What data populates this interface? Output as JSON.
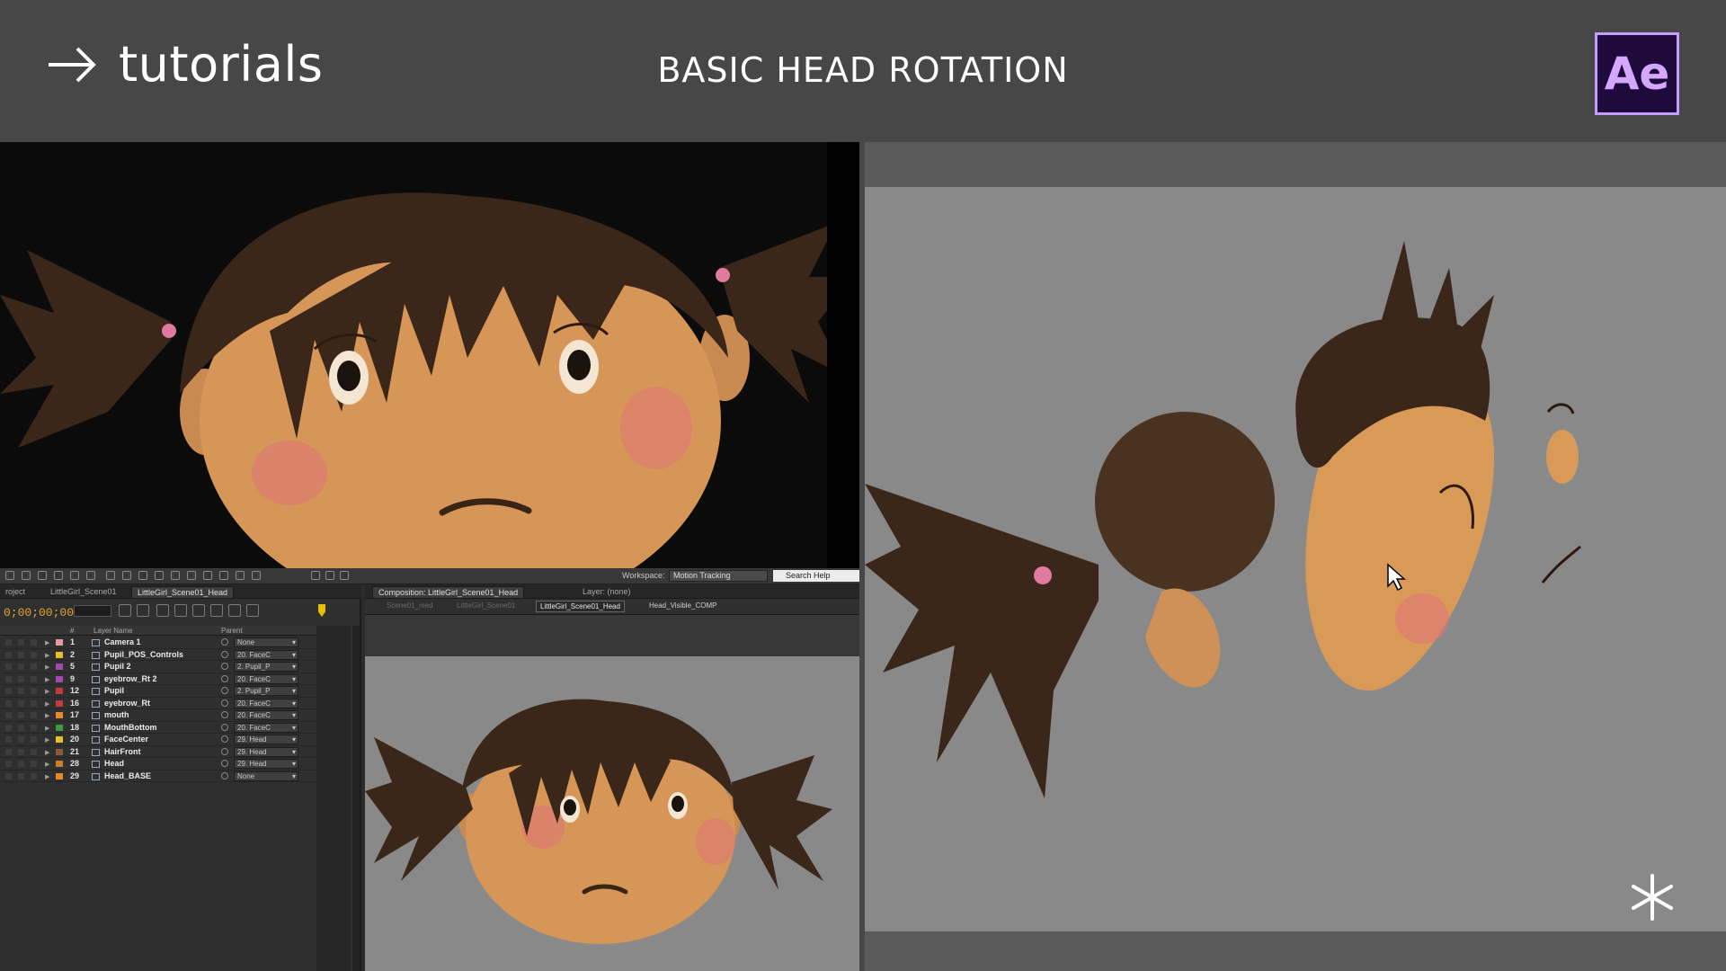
{
  "header": {
    "brand": "tutorials",
    "title": "BASIC HEAD ROTATION",
    "app_logo": "Ae"
  },
  "colors": {
    "header_bg": "#474747",
    "ae_logo_bg": "#1f0a3c",
    "ae_logo_border": "#c69cff",
    "timecode": "#e8a13a",
    "skin": "#d9955a",
    "hair": "#3d2a1c"
  },
  "icons": {
    "brand": "arrow-right-icon",
    "corner": "asterisk-icon",
    "cursor": "mouse-pointer-icon"
  },
  "toolbar": {
    "workspace_label": "Workspace:",
    "workspace_value": "Motion Tracking",
    "search_placeholder": "Search Help"
  },
  "timeline": {
    "tabs": [
      "roject",
      "LittleGirl_Scene01",
      "LittleGirl_Scene01_Head"
    ],
    "timecode": "0;00;00;00",
    "col_number": "#",
    "col_layer_name": "Layer Name",
    "col_parent": "Parent",
    "layers": [
      {
        "num": "1",
        "name": "Camera 1",
        "parent": "None",
        "label": "#e99a9a",
        "bar": "#d8a0a0"
      },
      {
        "num": "2",
        "name": "Pupil_POS_Controls",
        "parent": "20. FaceC",
        "label": "#e6c02a",
        "bar": "#d6b326"
      },
      {
        "num": "5",
        "name": "Pupil 2",
        "parent": "2. Pupil_P",
        "label": "#a24ab0",
        "bar": "#8a3a96"
      },
      {
        "num": "9",
        "name": "eyebrow_Rt 2",
        "parent": "20. FaceC",
        "label": "#a24ab0",
        "bar": "#8a3a96"
      },
      {
        "num": "12",
        "name": "Pupil",
        "parent": "2. Pupil_P",
        "label": "#c23b3b",
        "bar": "#a83232"
      },
      {
        "num": "16",
        "name": "eyebrow_Rt",
        "parent": "20. FaceC",
        "label": "#c23b3b",
        "bar": "#a83232"
      },
      {
        "num": "17",
        "name": "mouth",
        "parent": "20. FaceC",
        "label": "#e58a2a",
        "bar": "#d07a22"
      },
      {
        "num": "18",
        "name": "MouthBottom",
        "parent": "20. FaceC",
        "label": "#3e9a3e",
        "bar": "#358535"
      },
      {
        "num": "20",
        "name": "FaceCenter",
        "parent": "29. Head",
        "label": "#e6c02a",
        "bar": "#d6b326"
      },
      {
        "num": "21",
        "name": "HairFront",
        "parent": "29. Head",
        "label": "#8a5a3a",
        "bar": "#7a4e30"
      },
      {
        "num": "28",
        "name": "Head",
        "parent": "29. Head",
        "label": "#d07a2a",
        "bar": "#c06a20"
      },
      {
        "num": "29",
        "name": "Head_BASE",
        "parent": "None",
        "label": "#e58a2a",
        "bar": "#d07a22"
      }
    ]
  },
  "composition": {
    "tab_label": "Composition: LittleGirl_Scene01_Head",
    "layer_label": "Layer: (none)",
    "crumbs": [
      "Scene01_med",
      "LittleGirl_Scene01",
      "LittleGirl_Scene01_Head",
      "Head_Visible_COMP"
    ]
  }
}
